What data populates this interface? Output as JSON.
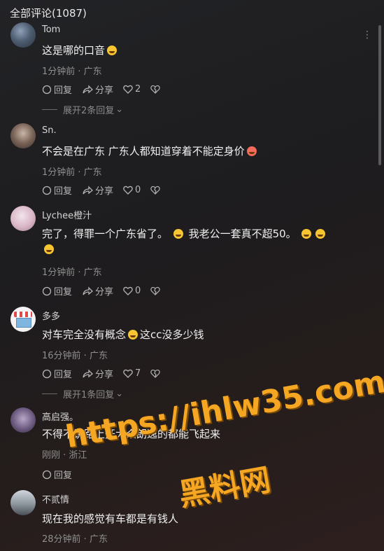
{
  "header": {
    "title": "全部评论(1087)"
  },
  "more_icon": "⋮",
  "comments": [
    {
      "name": "Tom",
      "text_before": "这是哪的口音",
      "meta": "1分钟前 · 广东",
      "reply": "回复",
      "share": "分享",
      "likes": "2",
      "expand": "展开2条回复"
    },
    {
      "name": "Sn.",
      "text_before": "不会是在广东  广东人都知道穿着不能定身价",
      "meta": "1分钟前 · 广东",
      "reply": "回复",
      "share": "分享",
      "likes": "0"
    },
    {
      "name": "Lychee橙汁",
      "text_a": "完了，得罪一个广东省了。",
      "text_b": "我老公一套真不超50。",
      "meta": "1分钟前 · 广东",
      "reply": "回复",
      "share": "分享",
      "likes": "0"
    },
    {
      "name": "多多",
      "text_a": "对车完全没有概念",
      "text_b": "这cc没多少钱",
      "meta": "16分钟前 · 广东",
      "reply": "回复",
      "share": "分享",
      "likes": "7",
      "expand": "展开1条回复"
    },
    {
      "name": "高启强。",
      "text_before": "不得不说路上开大众朗逸的都能飞起来",
      "meta": "刚刚 · 浙江",
      "reply": "回复"
    },
    {
      "name": "不贰情",
      "text_before": "现在我的感觉有车都是有钱人",
      "meta": "28分钟前 · 广东"
    }
  ],
  "watermark": {
    "line1": "https://ihlw35.com",
    "line2": "黑料网"
  }
}
